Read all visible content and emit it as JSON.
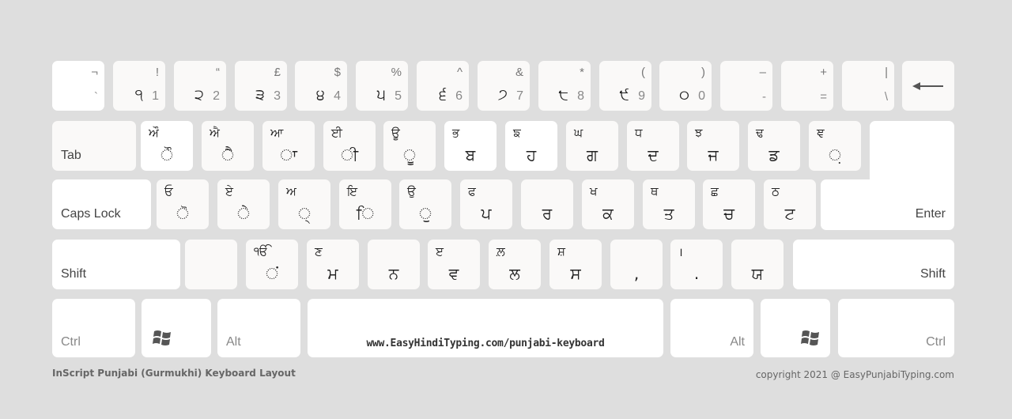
{
  "row1": [
    {
      "top": "¬",
      "bottom": "`"
    },
    {
      "top": "!",
      "pa": "੧",
      "en": "1"
    },
    {
      "top": "“",
      "pa": "੨",
      "en": "2"
    },
    {
      "top": "£",
      "pa": "੩",
      "en": "3"
    },
    {
      "top": "$",
      "pa": "੪",
      "en": "4"
    },
    {
      "top": "%",
      "pa": "੫",
      "en": "5"
    },
    {
      "top": "^",
      "pa": "੬",
      "en": "6"
    },
    {
      "top": "&",
      "pa": "੭",
      "en": "7"
    },
    {
      "top": "*",
      "pa": "੮",
      "en": "8"
    },
    {
      "top": "(",
      "pa": "੯",
      "en": "9"
    },
    {
      "top": ")",
      "pa": "੦",
      "en": "0"
    },
    {
      "top": "–",
      "bottom": "-"
    },
    {
      "top": "+",
      "bottom": "="
    },
    {
      "top": "|",
      "bottom": "\\"
    }
  ],
  "backspace_icon": "left-arrow-icon",
  "tab_label": "Tab",
  "row2": [
    {
      "top": "ਔ",
      "main": "ੌ"
    },
    {
      "top": "ਐ",
      "main": "ੈ"
    },
    {
      "top": "ਆ",
      "main": "ਾ"
    },
    {
      "top": "ਈ",
      "main": "ੀ"
    },
    {
      "top": "ਊ",
      "main": "ੂ"
    },
    {
      "top": "ਭ",
      "main": "ਬ"
    },
    {
      "top": "ਙ",
      "main": "ਹ"
    },
    {
      "top": "ਘ",
      "main": "ਗ"
    },
    {
      "top": "ਧ",
      "main": "ਦ"
    },
    {
      "top": "ਝ",
      "main": "ਜ"
    },
    {
      "top": "ਢ",
      "main": "ਡ"
    },
    {
      "top": "ਞ",
      "main": "਼"
    }
  ],
  "caps_label": "Caps Lock",
  "enter_label": "Enter",
  "row3": [
    {
      "top": "ਓ",
      "main": "ੋ"
    },
    {
      "top": "ਏ",
      "main": "ੇ"
    },
    {
      "top": "ਅ",
      "main": "੍"
    },
    {
      "top": "ਇ",
      "main": "ਿ"
    },
    {
      "top": "ਉ",
      "main": "ੁ"
    },
    {
      "top": "ਫ",
      "main": "ਪ"
    },
    {
      "top": "",
      "main": "ਰ"
    },
    {
      "top": "ਖ",
      "main": "ਕ"
    },
    {
      "top": "ਥ",
      "main": "ਤ"
    },
    {
      "top": "ਛ",
      "main": "ਚ"
    },
    {
      "top": "ਠ",
      "main": "ਟ"
    }
  ],
  "shift_label": "Shift",
  "row4": [
    {
      "top": "",
      "main": ""
    },
    {
      "top": "ੴ",
      "main": "ਂ"
    },
    {
      "top": "ਣ",
      "main": "ਮ"
    },
    {
      "top": "",
      "main": "ਨ"
    },
    {
      "top": "ੲ",
      "main": "ਵ"
    },
    {
      "top": "ਲ਼",
      "main": "ਲ"
    },
    {
      "top": "ਸ਼",
      "main": "ਸ"
    },
    {
      "top": "",
      "main": ","
    },
    {
      "top": "।",
      "main": "."
    },
    {
      "top": "",
      "main": "ਯ"
    }
  ],
  "ctrl_label": "Ctrl",
  "alt_label": "Alt",
  "windows_icon": "windows-logo-icon",
  "space_text": "www.EasyHindiTyping.com/punjabi-keyboard",
  "footer": {
    "title": "InScript Punjabi (Gurmukhi) Keyboard Layout",
    "copyright": "copyright 2021 @ EasyPunjabiTyping.com"
  }
}
